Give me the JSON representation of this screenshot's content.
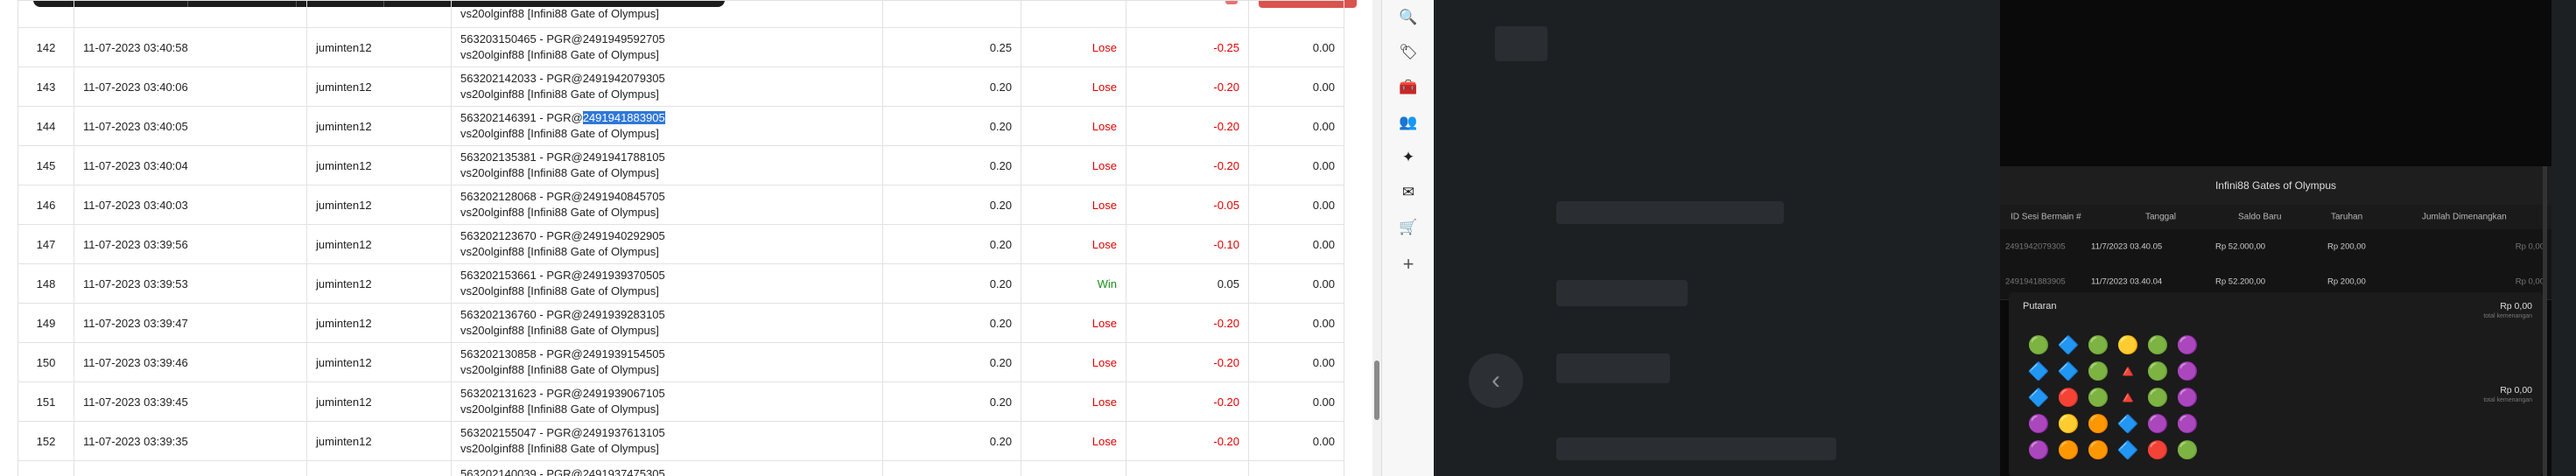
{
  "table": {
    "rows": [
      {
        "no": "142",
        "datetime": "11-07-2023 03:40:58",
        "user": "juminten12",
        "id_prefix": "563203150465 - PGR@",
        "id_code": "2491949592705",
        "game": "vs20olginf88 [Infini88 Gate of Olympus]",
        "bet": "0.25",
        "result": "Lose",
        "outcome": "-0.25",
        "win": "0.00"
      },
      {
        "no": "143",
        "datetime": "11-07-2023 03:40:06",
        "user": "juminten12",
        "id_prefix": "563202142033 - PGR@",
        "id_code": "2491942079305",
        "game": "vs20olginf88 [Infini88 Gate of Olympus]",
        "bet": "0.20",
        "result": "Lose",
        "outcome": "-0.20",
        "win": "0.00"
      },
      {
        "no": "144",
        "datetime": "11-07-2023 03:40:05",
        "user": "juminten12",
        "id_prefix": "563202146391 - PGR@",
        "id_code": "2491941883905",
        "game": "vs20olginf88 [Infini88 Gate of Olympus]",
        "bet": "0.20",
        "result": "Lose",
        "outcome": "-0.20",
        "win": "0.00",
        "highlight": true
      },
      {
        "no": "145",
        "datetime": "11-07-2023 03:40:04",
        "user": "juminten12",
        "id_prefix": "563202135381 - PGR@",
        "id_code": "2491941788105",
        "game": "vs20olginf88 [Infini88 Gate of Olympus]",
        "bet": "0.20",
        "result": "Lose",
        "outcome": "-0.20",
        "win": "0.00"
      },
      {
        "no": "146",
        "datetime": "11-07-2023 03:40:03",
        "user": "juminten12",
        "id_prefix": "563202128068 - PGR@",
        "id_code": "2491940845705",
        "game": "vs20olginf88 [Infini88 Gate of Olympus]",
        "bet": "0.20",
        "result": "Lose",
        "outcome": "-0.05",
        "win": "0.00"
      },
      {
        "no": "147",
        "datetime": "11-07-2023 03:39:56",
        "user": "juminten12",
        "id_prefix": "563202123670 - PGR@",
        "id_code": "2491940292905",
        "game": "vs20olginf88 [Infini88 Gate of Olympus]",
        "bet": "0.20",
        "result": "Lose",
        "outcome": "-0.10",
        "win": "0.00"
      },
      {
        "no": "148",
        "datetime": "11-07-2023 03:39:53",
        "user": "juminten12",
        "id_prefix": "563202153661 - PGR@",
        "id_code": "2491939370505",
        "game": "vs20olginf88 [Infini88 Gate of Olympus]",
        "bet": "0.20",
        "result": "Win",
        "outcome": "0.05",
        "win": "0.00"
      },
      {
        "no": "149",
        "datetime": "11-07-2023 03:39:47",
        "user": "juminten12",
        "id_prefix": "563202136760 - PGR@",
        "id_code": "2491939283105",
        "game": "vs20olginf88 [Infini88 Gate of Olympus]",
        "bet": "0.20",
        "result": "Lose",
        "outcome": "-0.20",
        "win": "0.00"
      },
      {
        "no": "150",
        "datetime": "11-07-2023 03:39:46",
        "user": "juminten12",
        "id_prefix": "563202130858 - PGR@",
        "id_code": "2491939154505",
        "game": "vs20olginf88 [Infini88 Gate of Olympus]",
        "bet": "0.20",
        "result": "Lose",
        "outcome": "-0.20",
        "win": "0.00"
      },
      {
        "no": "151",
        "datetime": "11-07-2023 03:39:45",
        "user": "juminten12",
        "id_prefix": "563202131623 - PGR@",
        "id_code": "2491939067105",
        "game": "vs20olginf88 [Infini88 Gate of Olympus]",
        "bet": "0.20",
        "result": "Lose",
        "outcome": "-0.20",
        "win": "0.00"
      },
      {
        "no": "152",
        "datetime": "11-07-2023 03:39:35",
        "user": "juminten12",
        "id_prefix": "563202155047 - PGR@",
        "id_code": "2491937613105",
        "game": "vs20olginf88 [Infini88 Gate of Olympus]",
        "bet": "0.20",
        "result": "Lose",
        "outcome": "-0.20",
        "win": "0.00"
      },
      {
        "no": "",
        "datetime": "",
        "user": "",
        "id_prefix": "563202140039 - PGR@",
        "id_code": "2491937475305",
        "game": "",
        "bet": "",
        "result": "",
        "outcome": "",
        "win": "",
        "partial": true
      }
    ],
    "top_partial_game": "vs20olginf88 [Infini88 Gate of Olympus]"
  },
  "sidebar": {
    "icons": [
      {
        "name": "search-icon",
        "glyph": "🔍"
      },
      {
        "name": "tag-icon",
        "glyph": "🏷"
      },
      {
        "name": "toolbox-icon",
        "glyph": "🧰"
      },
      {
        "name": "people-icon",
        "glyph": "👥"
      },
      {
        "name": "copilot-icon",
        "glyph": "✦"
      },
      {
        "name": "outlook-icon",
        "glyph": "✉"
      },
      {
        "name": "cart-icon",
        "glyph": "🛒"
      },
      {
        "name": "add-icon",
        "glyph": "+"
      }
    ]
  },
  "popup": {
    "title": "Infini88 Gates of Olympus",
    "columns": [
      "ID Sesi Bermain #",
      "Tanggal",
      "Saldo Baru",
      "Taruhan",
      "Jumlah Dimenangkan"
    ],
    "rows": [
      {
        "id": "2491942079305",
        "date": "11/7/2023 03.40.05",
        "balance": "Rp 52.000,00",
        "bet": "Rp 200,00",
        "won": "Rp 0,00"
      },
      {
        "id": "2491941883905",
        "date": "11/7/2023 03.40.04",
        "balance": "Rp 52.200,00",
        "bet": "Rp 200,00",
        "won": "Rp 0,00"
      }
    ],
    "putaran": {
      "label": "Putaran",
      "amount1": "Rp 0,00",
      "amount1_sub": "total kemenangan",
      "amount2": "Rp 0,00",
      "amount2_sub": "total kemenangan"
    },
    "grid": [
      [
        "🟢",
        "🔷",
        "🟢",
        "🟡",
        "🟢",
        "🟣"
      ],
      [
        "🔷",
        "🔷",
        "🟢",
        "🔺",
        "🟢",
        "🟣"
      ],
      [
        "🔷",
        "🔴",
        "🟢",
        "🔺",
        "🟢",
        "🟣"
      ],
      [
        "🟣",
        "🟡",
        "🟠",
        "🔷",
        "🟣",
        "🟣"
      ],
      [
        "🟣",
        "🟠",
        "🟠",
        "🔷",
        "🔴",
        "🟢"
      ]
    ]
  }
}
